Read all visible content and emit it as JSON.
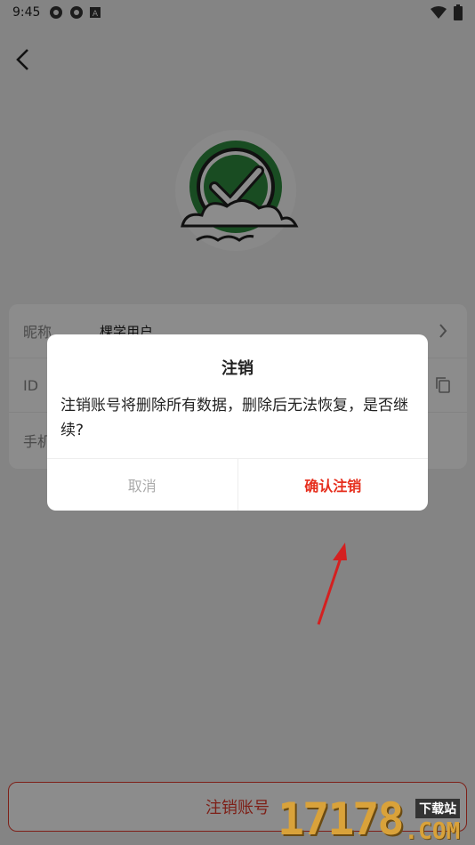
{
  "status_bar": {
    "time": "9:45"
  },
  "profile": {
    "rows": [
      {
        "label": "昵称",
        "value": "棵学用户"
      },
      {
        "label": "ID",
        "value": ""
      },
      {
        "label": "手机",
        "value": ""
      }
    ]
  },
  "footer": {
    "cancel_account_label": "注销账号"
  },
  "dialog": {
    "title": "注销",
    "message": "注销账号将删除所有数据，删除后无法恢复，是否继续?",
    "cancel_label": "取消",
    "confirm_label": "确认注销"
  },
  "watermark": {
    "digits": "17178",
    "top_text": "下载站",
    "com_text": ".COM"
  },
  "colors": {
    "accent_red": "#e53b2c",
    "avatar_green": "#2e8b3e"
  }
}
